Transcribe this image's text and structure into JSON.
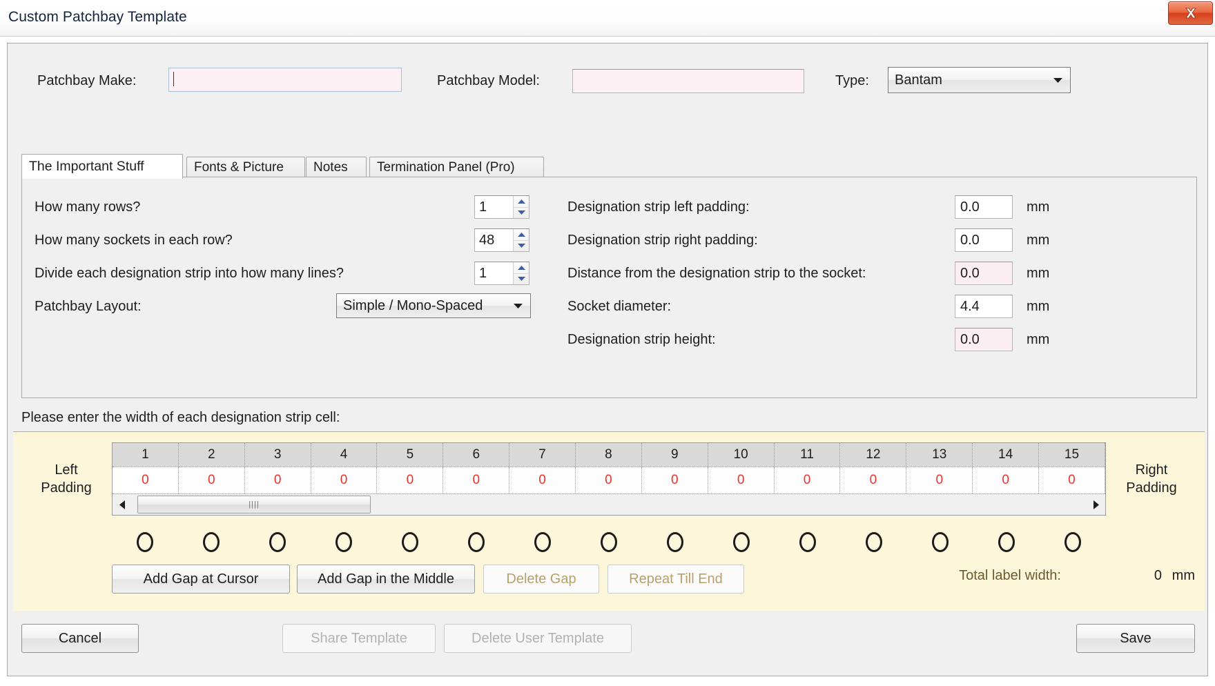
{
  "window": {
    "title": "Custom Patchbay Template",
    "close_icon": "close-x-icon"
  },
  "header": {
    "make_label": "Patchbay Make:",
    "make_value": "",
    "model_label": "Patchbay Model:",
    "model_value": "",
    "type_label": "Type:",
    "type_value": "Bantam",
    "type_options": [
      "Bantam"
    ],
    "dropdown_icon": "chevron-down-icon"
  },
  "tabs": [
    {
      "label": "The Important Stuff",
      "active": true
    },
    {
      "label": "Fonts & Picture",
      "active": false
    },
    {
      "label": "Notes",
      "active": false
    },
    {
      "label": "Termination Panel (Pro)",
      "active": false
    }
  ],
  "form_left": [
    {
      "label": "How many rows?",
      "value": "1",
      "control": "spinner"
    },
    {
      "label": "How many sockets in each row?",
      "value": "48",
      "control": "spinner"
    },
    {
      "label": "Divide each designation strip into how many lines?",
      "value": "1",
      "control": "spinner"
    }
  ],
  "layout": {
    "label": "Patchbay Layout:",
    "value": "Simple / Mono-Spaced",
    "options": [
      "Simple / Mono-Spaced"
    ]
  },
  "form_right": [
    {
      "label": "Designation strip left padding:",
      "value": "0.0",
      "unit": "mm",
      "pink": false
    },
    {
      "label": "Designation strip right padding:",
      "value": "0.0",
      "unit": "mm",
      "pink": false
    },
    {
      "label": "Distance from the designation strip to the socket:",
      "value": "0.0",
      "unit": "mm",
      "pink": true
    },
    {
      "label": "Socket diameter:",
      "value": "4.4",
      "unit": "mm",
      "pink": false
    },
    {
      "label": "Designation strip height:",
      "value": "0.0",
      "unit": "mm",
      "pink": true
    }
  ],
  "strip": {
    "prompt": "Please enter the width of each designation strip cell:",
    "left_padding_label": "Left\nPadding",
    "left_padding_line1": "Left",
    "left_padding_line2": "Padding",
    "right_padding_line1": "Right",
    "right_padding_line2": "Padding",
    "column_headers": [
      "1",
      "2",
      "3",
      "4",
      "5",
      "6",
      "7",
      "8",
      "9",
      "10",
      "11",
      "12",
      "13",
      "14",
      "15"
    ],
    "cell_values": [
      "0",
      "0",
      "0",
      "0",
      "0",
      "0",
      "0",
      "0",
      "0",
      "0",
      "0",
      "0",
      "0",
      "0",
      "0"
    ],
    "socket_count": 15,
    "scroll_left_icon": "triangle-left-icon",
    "scroll_right_icon": "triangle-right-icon",
    "scroll_grip_icon": "scroll-grip-icon",
    "cell_text_color": "#e8332e",
    "panel_background": "#fcf6da"
  },
  "gap_buttons": [
    {
      "label": "Add Gap at Cursor",
      "enabled": true
    },
    {
      "label": "Add Gap in the Middle",
      "enabled": true
    },
    {
      "label": "Delete Gap",
      "enabled": false
    },
    {
      "label": "Repeat Till End",
      "enabled": false
    }
  ],
  "total": {
    "label": "Total label width:",
    "value": "0",
    "unit": "mm"
  },
  "footer": [
    {
      "label": "Cancel",
      "enabled": true
    },
    {
      "label": "Share Template",
      "enabled": false
    },
    {
      "label": "Delete User Template",
      "enabled": false
    },
    {
      "label": "Save",
      "enabled": true
    }
  ]
}
